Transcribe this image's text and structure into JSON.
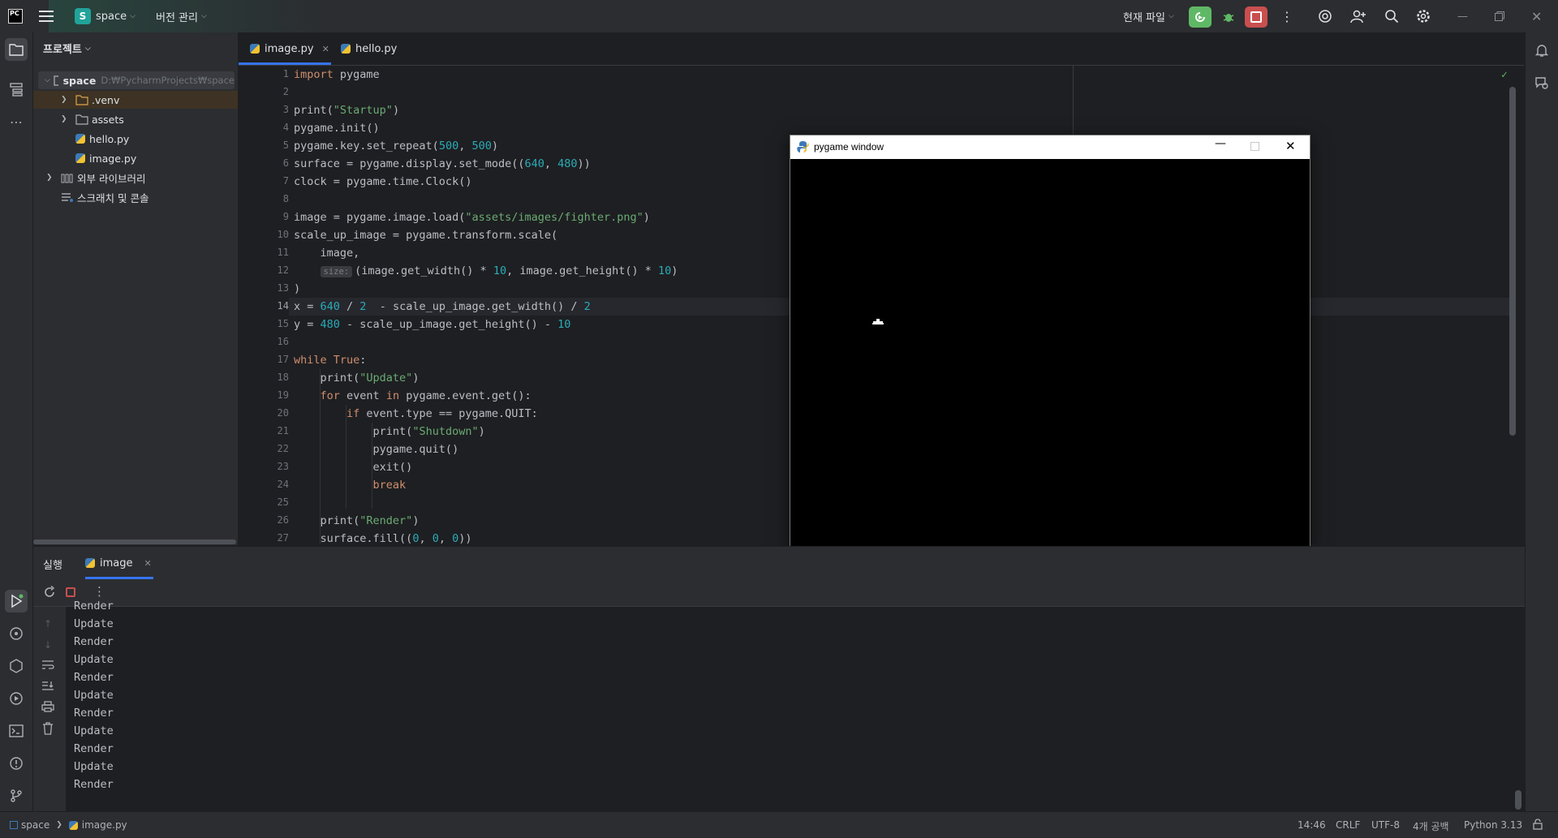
{
  "titlebar": {
    "project_badge": "S",
    "project_name": "space",
    "vcs_label": "버전 관리",
    "run_config": "현재 파일"
  },
  "project_panel": {
    "title": "프로젝트",
    "root_name": "space",
    "root_path": "D:₩PycharmProjects₩space",
    "items": [
      {
        "label": ".venv"
      },
      {
        "label": "assets"
      },
      {
        "label": "hello.py"
      },
      {
        "label": "image.py"
      },
      {
        "label": "외부 라이브러리"
      },
      {
        "label": "스크래치 및 콘솔"
      }
    ]
  },
  "editor": {
    "tabs": [
      {
        "label": "image.py",
        "active": true
      },
      {
        "label": "hello.py",
        "active": false
      }
    ],
    "current_line": 14,
    "inlay_hint": "size:"
  },
  "pygame_window": {
    "title": "pygame window"
  },
  "run_panel": {
    "title": "실행",
    "tab_label": "image",
    "partial_line": "Render",
    "lines": [
      "Update",
      "Render",
      "Update",
      "Render",
      "Update",
      "Render",
      "Update",
      "Render",
      "Update",
      "Render"
    ]
  },
  "status": {
    "breadcrumb_project": "space",
    "breadcrumb_file": "image.py",
    "cursor": "14:46",
    "line_sep": "CRLF",
    "encoding": "UTF-8",
    "indent": "4개 공백",
    "interpreter": "Python 3.13"
  },
  "colors": {
    "accent_green": "#5fb865",
    "stop_red": "#c94f4f",
    "python_blue": "#3d7ab7"
  }
}
